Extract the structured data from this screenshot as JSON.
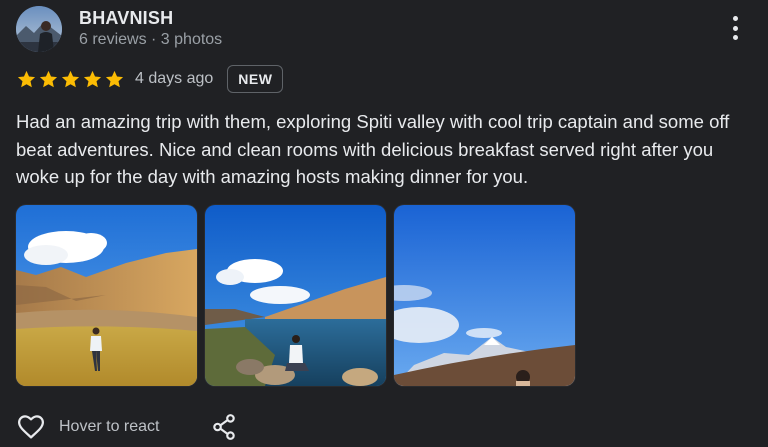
{
  "review": {
    "reviewer_name": "BHAVNISH",
    "reviewer_meta": "6 reviews · 3 photos",
    "rating": 5,
    "max_rating": 5,
    "date": "4 days ago",
    "badge": "NEW",
    "text": "Had an amazing trip with them, exploring Spiti valley with cool trip captain and some off beat adventures. Nice and clean rooms with delicious breakfast served right after you woke up for the day with amazing hosts making dinner for you.",
    "photos": [
      "valley-person-photo",
      "lake-person-photo",
      "mountain-sky-photo"
    ]
  },
  "actions": {
    "react_label": "Hover to react",
    "react_icon": "heart-outline-icon",
    "share_icon": "share-icon",
    "more_icon": "more-vertical-icon"
  },
  "colors": {
    "background": "#202124",
    "star": "#fbbc04",
    "text": "#e8eaed",
    "muted": "#9aa0a6"
  }
}
